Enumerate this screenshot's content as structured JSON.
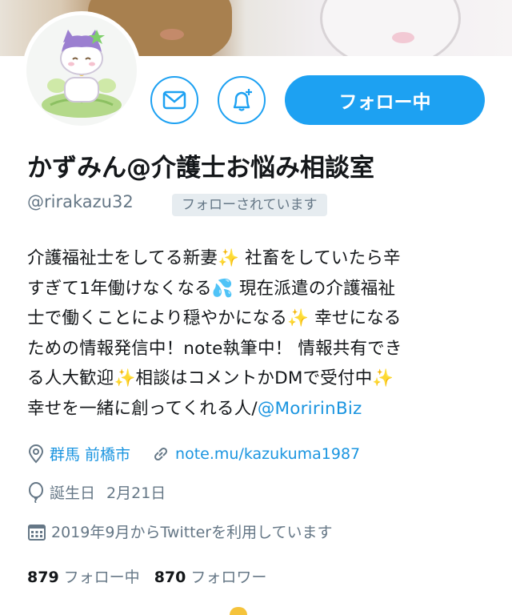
{
  "profile": {
    "display_name": "かずみん@介護士お悩み相談室",
    "handle": "@rirakazu32",
    "follows_you_badge": "フォローされています",
    "follow_button_label": "フォロー中",
    "bio": {
      "line1": "介護福祉士をしてる新妻",
      "line1b": " 社畜をしていたら辛",
      "line2": "すぎて1年働けなくなる",
      "line2b": " 現在派遣の介護福祉",
      "line3": "士で働くことにより穏やかになる",
      "line3b": " 幸せになる",
      "line4": "ための情報発信中！note執筆中！ 情報共有でき",
      "line5": "る人大歓迎",
      "line5b": "相談はコメントかDMで受付中",
      "line6": "幸せを一緒に創ってくれる人/",
      "mention": "@MoririnBiz"
    },
    "location": "群馬 前橋市",
    "website": "note.mu/kazukuma1987",
    "birthday_label": "誕生日",
    "birthday": "2月21日",
    "joined": "2019年9月からTwitterを利用しています",
    "following_count": "879",
    "following_label": "フォロー中",
    "followers_count": "870",
    "followers_label": "フォロワー"
  },
  "icons": [
    "mail-icon",
    "bell-plus-icon",
    "location-pin-icon",
    "link-icon",
    "balloon-icon",
    "calendar-icon",
    "sparkles-emoji",
    "sweat-drops-emoji"
  ],
  "colors": {
    "accent": "#1da1f2",
    "link": "#1b95e0",
    "muted": "#657786",
    "text": "#14171a"
  }
}
